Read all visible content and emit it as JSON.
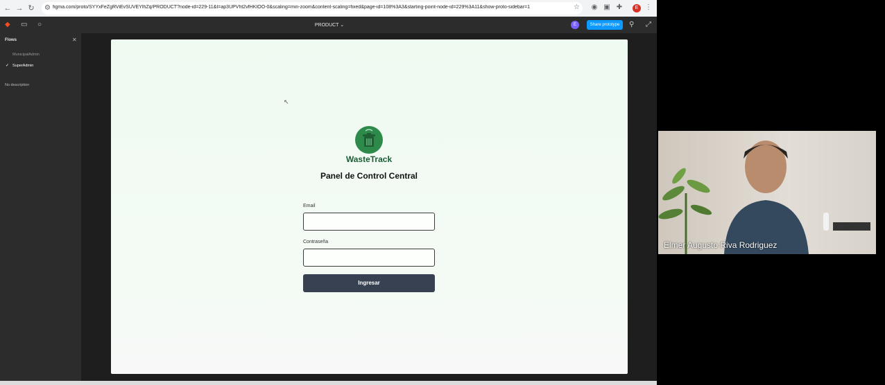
{
  "browser": {
    "url": "figma.com/proto/SYYxFeZgRViEvSUVEYlhZq/PRODUCT?node-id=229-11&t=ap3UPVht2vfHKIOO-0&scaling=min-zoom&content-scaling=fixed&page-id=108%3A3&starting-point-node-id=229%3A11&show-proto-sidebar=1",
    "profile_initial": "E"
  },
  "figma": {
    "file_title": "PRODUCT",
    "avatar_initial": "E",
    "share_label": "Share prototype"
  },
  "sidebar": {
    "title": "Flows",
    "items": [
      {
        "label": "MunicipalAdmin",
        "selected": false
      },
      {
        "label": "SuperAdmin",
        "selected": true
      }
    ],
    "description": "No description"
  },
  "login": {
    "brand": "WasteTrack",
    "heading": "Panel de Control Central",
    "email_label": "Email",
    "password_label": "Contraseña",
    "submit_label": "Ingresar"
  },
  "video": {
    "participant_name": "Elmer Augusto Riva Rodriguez"
  },
  "colors": {
    "accent_blue": "#0d99ff",
    "brand_green": "#2e8a4a",
    "button_dark": "#374151",
    "frame_bg": "#effaf1"
  }
}
